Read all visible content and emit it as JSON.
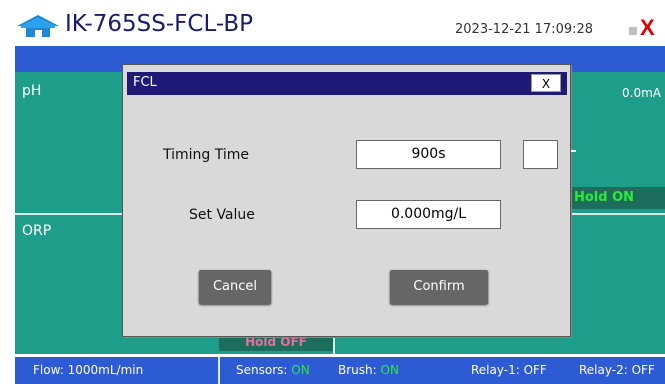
{
  "header": {
    "device_name": "IK-765SS-FCL-BP",
    "datetime": "2023-12-21 17:09:28",
    "close_symbol": "X",
    "home_icon": "home-icon",
    "colors": {
      "title": "#1a1a6e",
      "close": "#e00000",
      "accent": "#2d5bd4",
      "panel": "#1d9d8a"
    }
  },
  "panels": {
    "ph_label": "pH",
    "ph_value": "0.0mA",
    "orp_label": "ORP",
    "hold_on": "Hold ON",
    "hold_off": "Hold OFF"
  },
  "statusbar": {
    "flow_label": "Flow:",
    "flow_value": "1000mL/min",
    "sensors_label": "Sensors:",
    "sensors_value": "ON",
    "brush_label": "Brush:",
    "brush_value": "ON",
    "relay1": "Relay-1: OFF",
    "relay2": "Relay-2: OFF"
  },
  "dialog": {
    "title": "FCL",
    "close_label": "X",
    "timing_label": "Timing Time",
    "timing_value": "900s",
    "set_label": "Set Value",
    "set_value": "0.000mg/L",
    "cancel_label": "Cancel",
    "confirm_label": "Confirm"
  }
}
